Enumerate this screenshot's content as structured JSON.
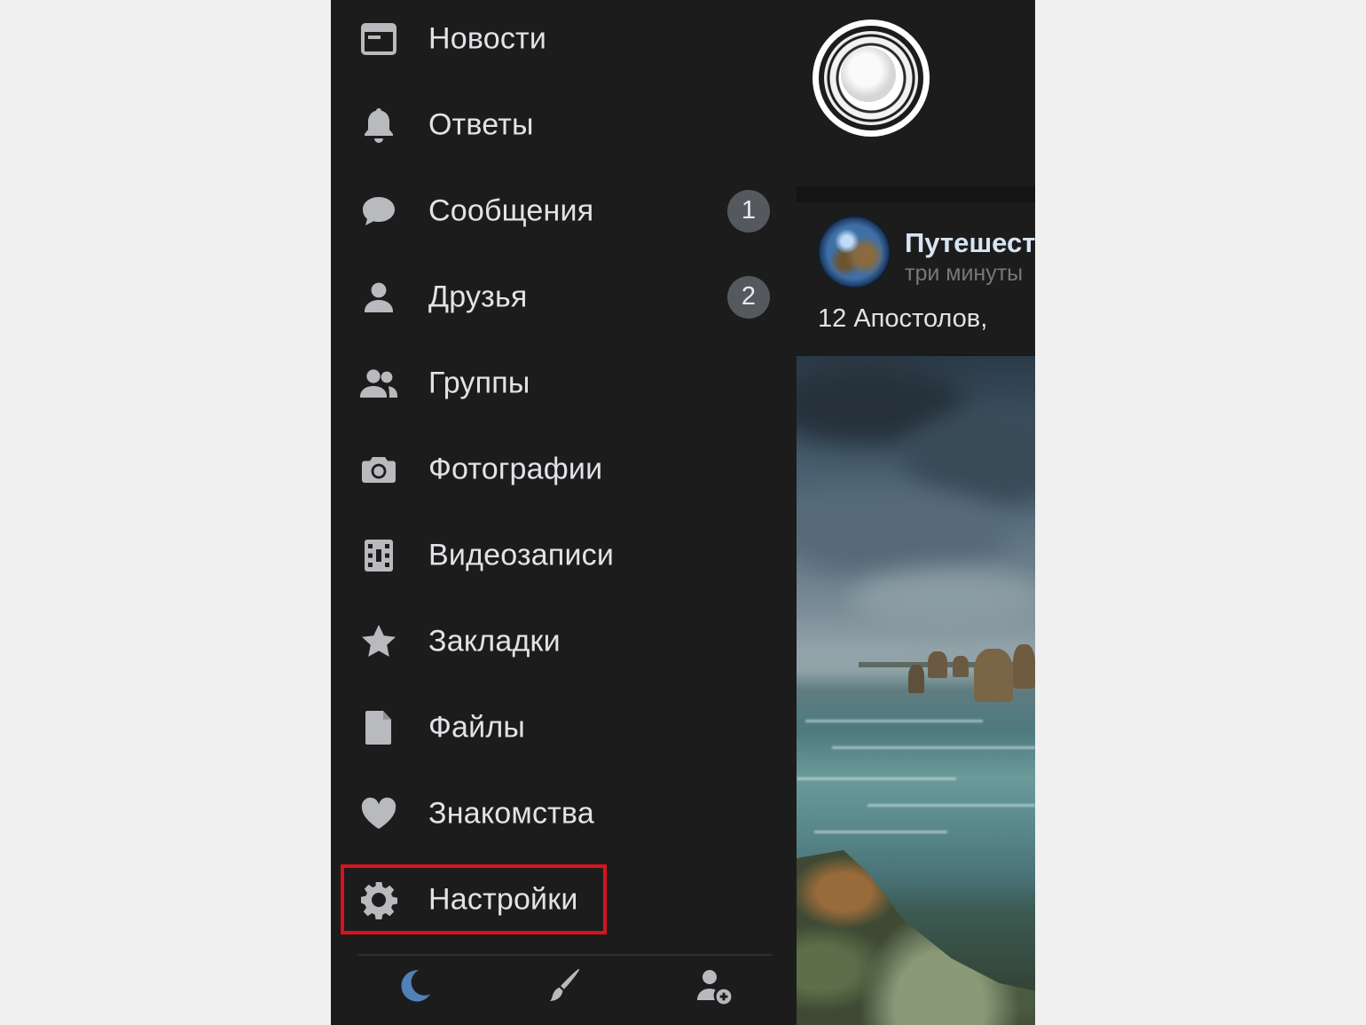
{
  "menu": {
    "items": [
      {
        "label": "Новости",
        "icon": "newspaper-icon",
        "badge": ""
      },
      {
        "label": "Ответы",
        "icon": "bell-icon",
        "badge": ""
      },
      {
        "label": "Сообщения",
        "icon": "chat-bubble-icon",
        "badge": "1"
      },
      {
        "label": "Друзья",
        "icon": "person-icon",
        "badge": "2"
      },
      {
        "label": "Группы",
        "icon": "people-icon",
        "badge": ""
      },
      {
        "label": "Фотографии",
        "icon": "camera-icon",
        "badge": ""
      },
      {
        "label": "Видеозаписи",
        "icon": "film-icon",
        "badge": ""
      },
      {
        "label": "Закладки",
        "icon": "star-icon",
        "badge": ""
      },
      {
        "label": "Файлы",
        "icon": "file-icon",
        "badge": ""
      },
      {
        "label": "Знакомства",
        "icon": "heart-icon",
        "badge": ""
      },
      {
        "label": "Настройки",
        "icon": "gear-icon",
        "badge": ""
      }
    ],
    "highlighted_item": "Настройки",
    "bottom_bar": [
      "moon-icon",
      "brush-icon",
      "add-user-icon"
    ]
  },
  "feed": {
    "post": {
      "author": "Путешест",
      "time": "три минуты",
      "text": "12 Апостолов,"
    }
  },
  "colors": {
    "background": "#1c1c1d",
    "text": "#e1e3e6",
    "icon": "#b8babd",
    "badge": "#55595e",
    "highlight": "#d5141d",
    "accent": "#5181b8"
  }
}
